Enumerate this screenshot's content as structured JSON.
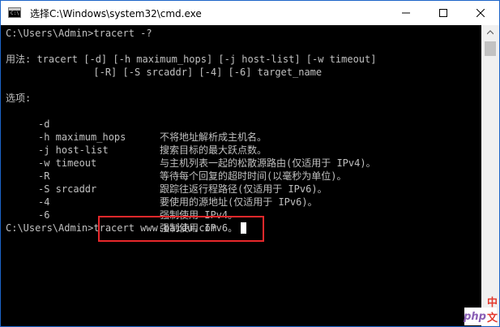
{
  "window": {
    "title": "选择C:\\Windows\\system32\\cmd.exe",
    "icon": "cmd-icon",
    "icon_prompt": "C:\\",
    "controls": {
      "minimize": "minimize-icon",
      "maximize": "maximize-icon",
      "close": "close-icon"
    }
  },
  "console": {
    "prompt1": "C:\\Users\\Admin>tracert -?",
    "usage1": "用法: tracert [-d] [-h maximum_hops] [-j host-list] [-w timeout]",
    "usage2": "               [-R] [-S srcaddr] [-4] [-6] target_name",
    "options_header": "选项:",
    "options": [
      {
        "flag": "-d",
        "desc": "不将地址解析成主机名。"
      },
      {
        "flag": "-h maximum_hops",
        "desc": "搜索目标的最大跃点数。"
      },
      {
        "flag": "-j host-list",
        "desc": "与主机列表一起的松散源路由(仅适用于 IPv4)。"
      },
      {
        "flag": "-w timeout",
        "desc": "等待每个回复的超时时间(以毫秒为单位)。"
      },
      {
        "flag": "-R",
        "desc": "跟踪往返行程路径(仅适用于 IPv6)。"
      },
      {
        "flag": "-S srcaddr",
        "desc": "要使用的源地址(仅适用于 IPv6)。"
      },
      {
        "flag": "-4",
        "desc": "强制使用 IPv4。"
      },
      {
        "flag": "-6",
        "desc": "强制使用 IPv6。"
      }
    ],
    "prompt2": "C:\\Users\\Admin>tracert www.baidu.com"
  },
  "colors": {
    "console_bg": "#000000",
    "console_text": "#c0c0c0",
    "highlight": "#e8282b",
    "window_border": "#1c64c8"
  },
  "watermark": {
    "part1": "php",
    "part2": "中文网"
  }
}
